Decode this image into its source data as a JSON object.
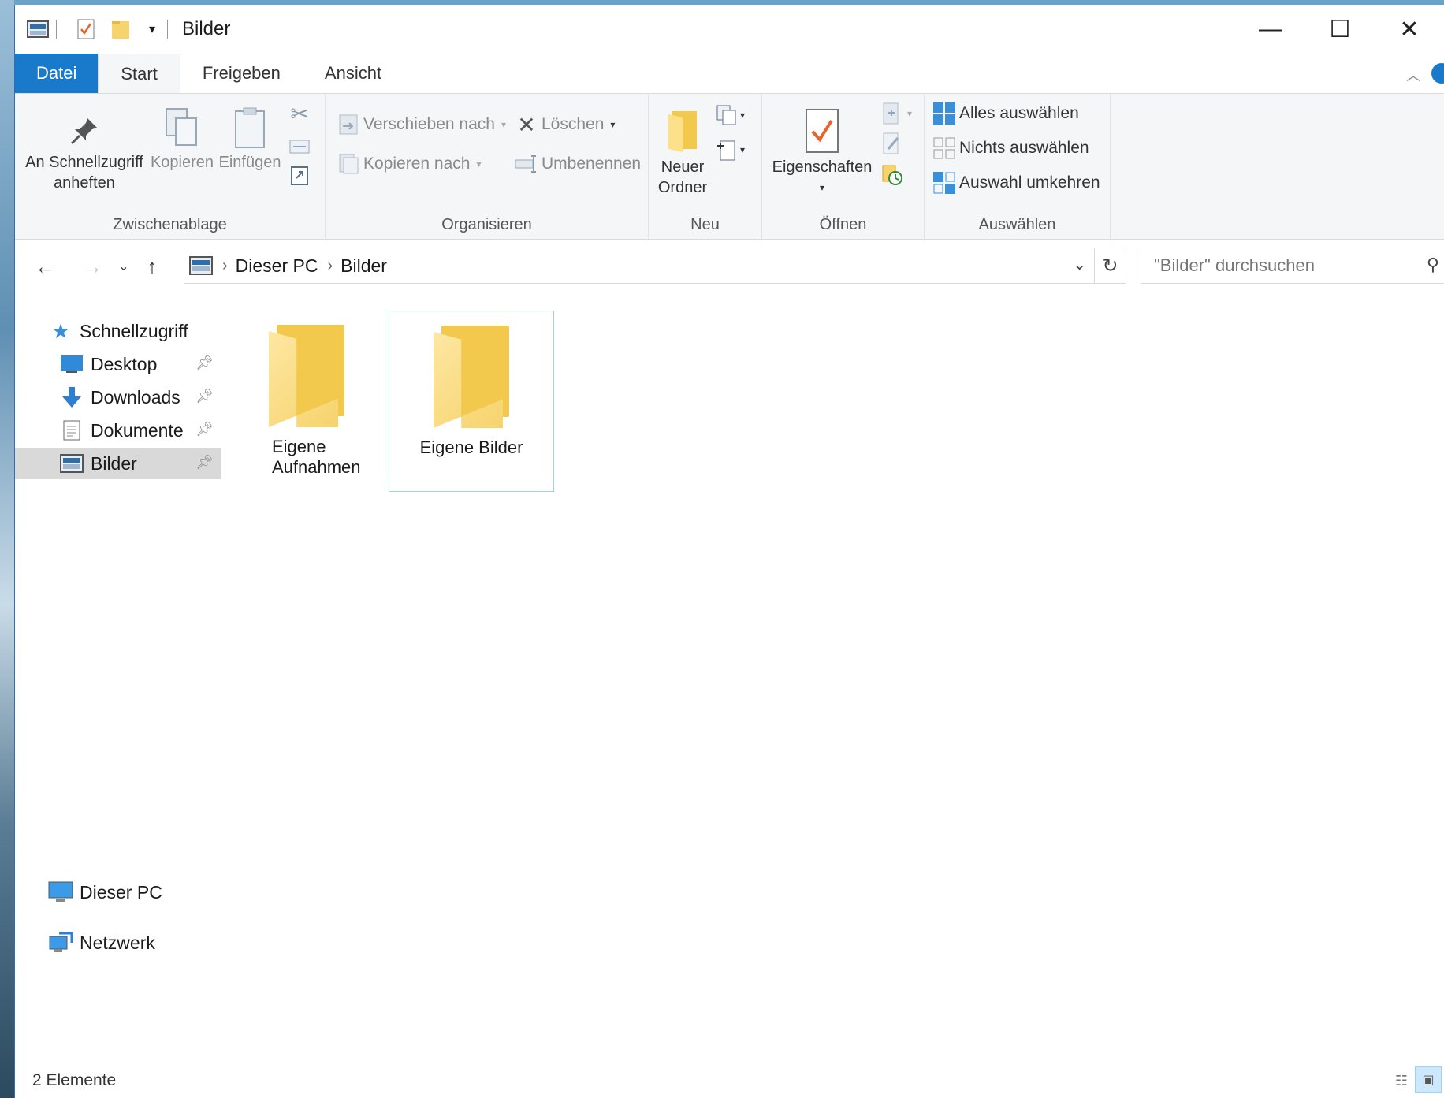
{
  "window": {
    "title": "Bilder",
    "min_glyph": "—",
    "max_glyph": "☐",
    "close_glyph": "✕"
  },
  "ribbon_tabs": [
    "Datei",
    "Start",
    "Freigeben",
    "Ansicht"
  ],
  "ribbon": {
    "zwischenablage": {
      "label": "Zwischenablage",
      "pin_line1": "An Schnellzugriff",
      "pin_line2": "anheften",
      "copy": "Kopieren",
      "paste": "Einfügen"
    },
    "organisieren": {
      "label": "Organisieren",
      "move_to": "Verschieben nach",
      "copy_to": "Kopieren nach",
      "delete": "Löschen",
      "rename": "Umbenennen"
    },
    "neu": {
      "label": "Neu",
      "new_folder_line1": "Neuer",
      "new_folder_line2": "Ordner"
    },
    "oeffnen": {
      "label": "Öffnen",
      "properties": "Eigenschaften"
    },
    "auswaehlen": {
      "label": "Auswählen",
      "select_all": "Alles auswählen",
      "select_none": "Nichts auswählen",
      "invert": "Auswahl umkehren"
    }
  },
  "address": {
    "crumbs": [
      "Dieser PC",
      "Bilder"
    ],
    "search_placeholder": "\"Bilder\" durchsuchen"
  },
  "nav": {
    "quick_access": "Schnellzugriff",
    "items": [
      "Desktop",
      "Downloads",
      "Dokumente",
      "Bilder"
    ],
    "this_pc": "Dieser PC",
    "network": "Netzwerk"
  },
  "content": {
    "folders": [
      {
        "line1": "Eigene",
        "line2": "Aufnahmen"
      },
      {
        "line1": "Eigene Bilder",
        "line2": ""
      }
    ]
  },
  "status": {
    "count": "2 Elemente"
  },
  "colors": {
    "accent": "#1979ca",
    "ribbon_bg": "#f5f6f7",
    "selection": "#cce8ff",
    "folder": "#f6d36c"
  }
}
